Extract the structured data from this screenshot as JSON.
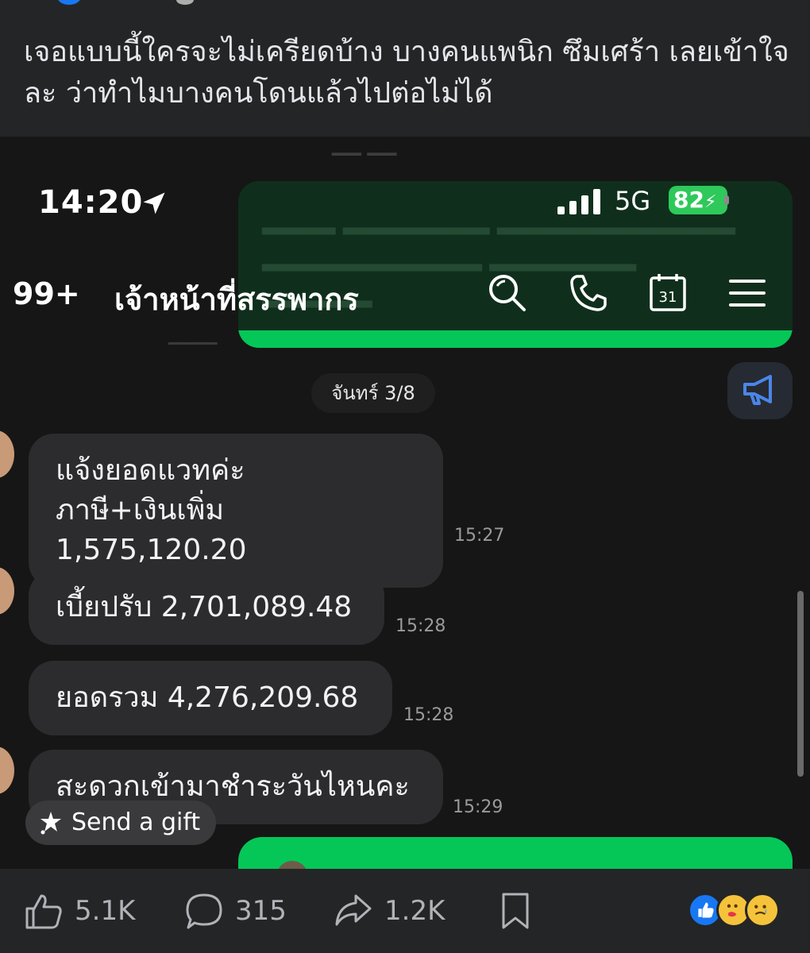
{
  "post": {
    "caption": "เจอแบบนี้ใครจะไม่เครียดบ้าง บางคนแพนิก ซึมเศร้า เลยเข้าใจละ ว่าทำไมบางคนโดนแล้วไปต่อไม่ได้"
  },
  "screenshot": {
    "status_bar": {
      "time": "14:20",
      "network": "5G",
      "battery": "82"
    },
    "chat_header": {
      "unread_count": "99+",
      "contact_name": "เจ้าหน้าที่สรรพากร",
      "calendar_day": "31"
    },
    "date_separator": "จันทร์ 3/8",
    "messages": [
      {
        "text": "แจ้งยอดแวทค่ะ\nภาษี+เงินเพิ่ม 1,575,120.20",
        "time": "15:27"
      },
      {
        "text": "เบี้ยปรับ 2,701,089.48",
        "time": "15:28"
      },
      {
        "text": "ยอดรวม 4,276,209.68",
        "time": "15:28"
      },
      {
        "text": "สะดวกเข้ามาชำระวันไหนคะ",
        "time": "15:29"
      }
    ],
    "gift_button": "Send a gift"
  },
  "footer": {
    "likes": "5.1K",
    "comments": "315",
    "shares": "1.2K"
  },
  "colors": {
    "line_green": "#05c757",
    "bubble_dark": "#2c2c2e",
    "battery_green": "#2ec95a",
    "fb_blue": "#1877f2"
  },
  "icons": [
    "location-arrow-icon",
    "signal-icon",
    "search-icon",
    "phone-icon",
    "calendar-icon",
    "menu-icon",
    "megaphone-icon",
    "gift-icon",
    "like-icon",
    "comment-icon",
    "share-icon",
    "bookmark-icon"
  ]
}
